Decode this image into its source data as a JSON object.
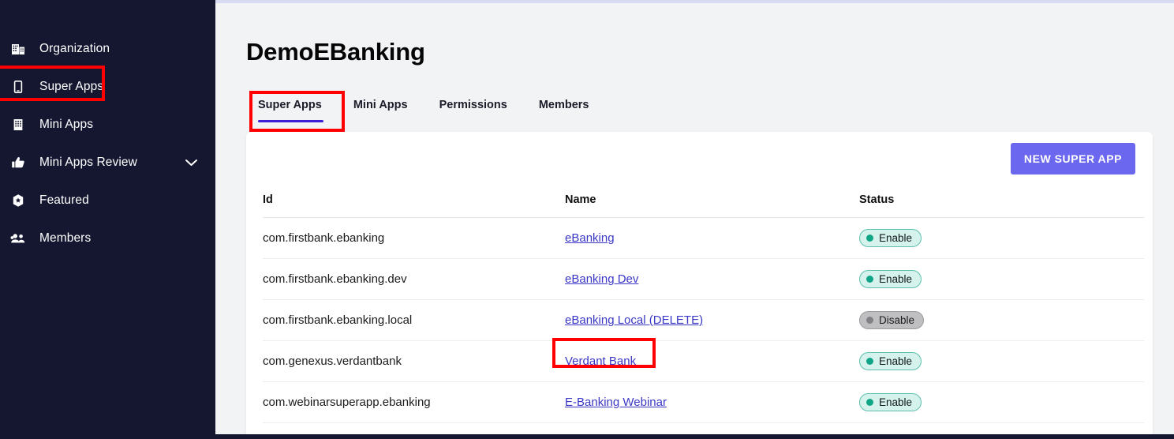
{
  "sidebar": {
    "items": [
      {
        "label": "Organization",
        "icon": "building-icon",
        "has_chevron": false
      },
      {
        "label": "Super Apps",
        "icon": "mobile-phone-icon",
        "has_chevron": false
      },
      {
        "label": "Mini Apps",
        "icon": "grid-building-icon",
        "has_chevron": false
      },
      {
        "label": "Mini Apps Review",
        "icon": "thumbs-up-icon",
        "has_chevron": true
      },
      {
        "label": "Featured",
        "icon": "badge-star-icon",
        "has_chevron": false
      },
      {
        "label": "Members",
        "icon": "people-group-icon",
        "has_chevron": false
      }
    ]
  },
  "header": {
    "title": "DemoEBanking"
  },
  "tabs": [
    {
      "label": "Super Apps",
      "active": true
    },
    {
      "label": "Mini Apps",
      "active": false
    },
    {
      "label": "Permissions",
      "active": false
    },
    {
      "label": "Members",
      "active": false
    }
  ],
  "toolbar": {
    "new_super_app_label": "NEW SUPER APP"
  },
  "table": {
    "columns": [
      "Id",
      "Name",
      "Status"
    ],
    "rows": [
      {
        "id": "com.firstbank.ebanking",
        "name": "eBanking",
        "status": "Enable"
      },
      {
        "id": "com.firstbank.ebanking.dev",
        "name": "eBanking Dev",
        "status": "Enable"
      },
      {
        "id": "com.firstbank.ebanking.local",
        "name": "eBanking Local (DELETE)",
        "status": "Disable"
      },
      {
        "id": "com.genexus.verdantbank",
        "name": "Verdant Bank",
        "status": "Enable"
      },
      {
        "id": "com.webinarsuperapp.ebanking",
        "name": "E-Banking Webinar",
        "status": "Enable"
      }
    ]
  },
  "colors": {
    "sidebar_bg": "#151730",
    "accent_purple": "#6b68ef",
    "tab_underline": "#3d20d6",
    "link": "#3b37c7",
    "enable_badge_bg": "#d6f2ec",
    "enable_badge_dot": "#11a587",
    "disable_badge_bg": "#bfbfc2",
    "disable_badge_dot": "#808085",
    "highlight_red": "#ff0000"
  }
}
